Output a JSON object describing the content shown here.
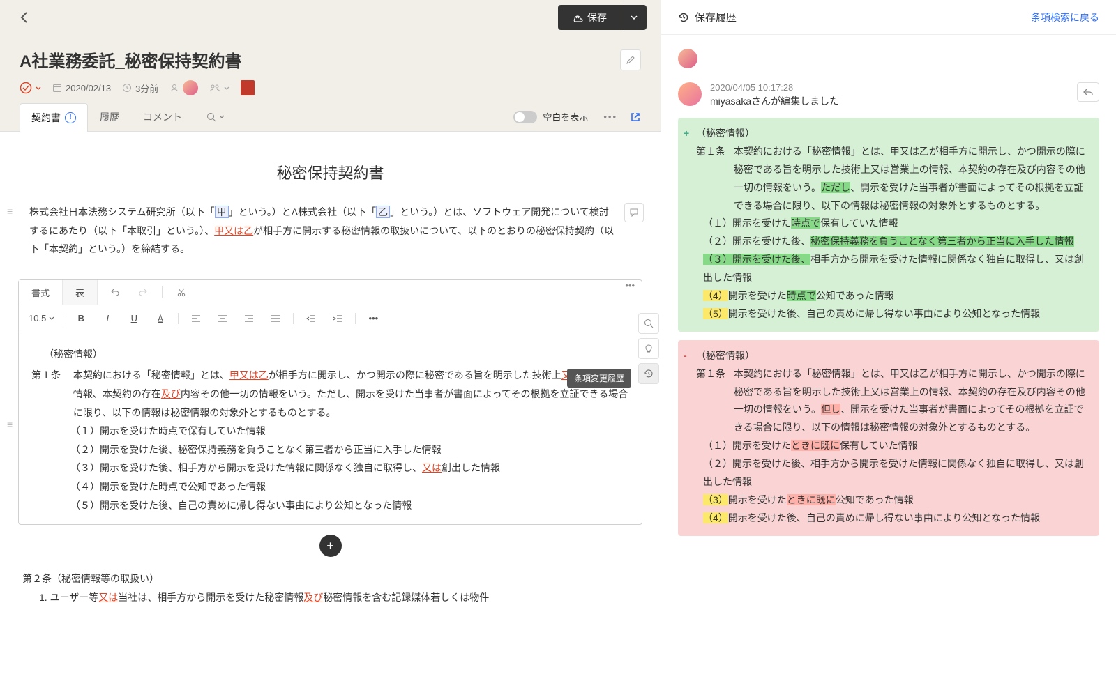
{
  "header": {
    "save_label": "保存"
  },
  "doc": {
    "title": "A社業務委託_秘密保持契約書",
    "date": "2020/02/13",
    "time_ago": "3分前"
  },
  "tabs": {
    "contract": "契約書",
    "history": "履歴",
    "comment": "コメント",
    "show_blank": "空白を表示"
  },
  "body": {
    "title": "秘密保持契約書",
    "pre_1": "株式会社日本法務システム研究所（以下「",
    "pre_ko": "甲",
    "pre_2": "」という。）とA株式会社（以下「",
    "pre_otsu": "乙",
    "pre_3": "」という。）とは、ソフトウェア開発について検討するにあたり（以下「本取引」という。）、",
    "pre_redspan": "甲又は乙",
    "pre_4": "が相手方に開示する秘密情報の取扱いについて、以下のとおりの秘密保持契約（以下「本契約」という。）を締結する。"
  },
  "editor": {
    "tab_format": "書式",
    "tab_table": "表",
    "font_size": "10.5",
    "b": "B",
    "i": "I",
    "u": "U",
    "section_title": "（秘密情報）",
    "art_num": "第１条",
    "art_body_1": "本契約における「秘密情報」とは、",
    "art_red_1": "甲又は乙",
    "art_body_2": "が相手方に開示し、かつ開示の際に秘密である旨を明示した技術上",
    "art_red_2": "又は",
    "art_body_3": "営業上の情報、本契約の存在",
    "art_red_3": "及び",
    "art_body_4": "内容その他一切の情報をいう。ただし、開示を受けた当事者が書面によってその根拠を立証できる場合に限り、以下の情報は秘密情報の対象外とするものとする。",
    "li1": "（１）開示を受けた時点で保有していた情報",
    "li2": "（２）開示を受けた後、秘密保持義務を負うことなく第三者から正当に入手した情報",
    "li3_a": "（３）開示を受けた後、相手方から開示を受けた情報に関係なく独自に取得し、",
    "li3_red": "又は",
    "li3_b": "創出した情報",
    "li4": "（４）開示を受けた時点で公知であった情報",
    "li5": "（５）開示を受けた後、自己の責めに帰し得ない事由により公知となった情報",
    "art2_title": "第２条（秘密情報等の取扱い）",
    "art2_li_a": "1. ユーザー等",
    "art2_li_red": "又は",
    "art2_li_b": "当社は、相手方から開示を受けた秘密情報",
    "art2_li_red2": "及び",
    "art2_li_c": "秘密情報を含む記録媒体若しくは物件"
  },
  "tooltip": "条項変更履歴",
  "right": {
    "title": "保存履歴",
    "back_link": "条項検索に戻る",
    "timestamp": "2020/04/05 10:17:28",
    "author": "miyasakaさんが編集しました"
  },
  "diff_add": {
    "sign": "+",
    "section": "（秘密情報）",
    "art_num": "第１条",
    "body_1": "本契約における「秘密情報」とは、甲又は乙が相手方に開示し、かつ開示の際に秘密である旨を明示した技術上又は営業上の情報、本契約の存在及び内容その他一切の情報をいう。",
    "hl_tadashi": "ただし",
    "body_2": "、開示を受けた当事者が書面によってその根拠を立証できる場合に限り、以下の情報は秘密情報の対象外とするものとする。",
    "li1_a": "（１）開示を受けた",
    "li1_hl": "時点で",
    "li1_b": "保有していた情報",
    "li2_a": "（２）開示を受けた後、",
    "li2_hl": "秘密保持義務を負うことなく第三者から正当に入手した情報",
    "li3_hl": "（３）開示を受けた後、",
    "li3_b": "相手方から開示を受けた情報に関係なく独自に取得し、又は創出した情報",
    "li4_num": "（4）",
    "li4_a": "開示を受けた",
    "li4_hl": "時点で",
    "li4_b": "公知であった情報",
    "li5_num": "（5）",
    "li5": "開示を受けた後、自己の責めに帰し得ない事由により公知となった情報"
  },
  "diff_del": {
    "sign": "-",
    "section": "（秘密情報）",
    "art_num": "第１条",
    "body_1": "本契約における「秘密情報」とは、甲又は乙が相手方に開示し、かつ開示の際に秘密である旨を明示した技術上又は営業上の情報、本契約の存在及び内容その他一切の情報をいう。",
    "hl_tadashi": "但し",
    "body_2": "、開示を受けた当事者が書面によってその根拠を立証できる場合に限り、以下の情報は秘密情報の対象外とするものとする。",
    "li1_a": "（１）開示を受けた",
    "li1_hl": "ときに既に",
    "li1_b": "保有していた情報",
    "li2": "（２）開示を受けた後、相手方から開示を受けた情報に関係なく独自に取得し、又は創出した情報",
    "li3_num": "（3）",
    "li3_a": "開示を受けた",
    "li3_hl": "ときに既に",
    "li3_b": "公知であった情報",
    "li4_num": "（4）",
    "li4": "開示を受けた後、自己の責めに帰し得ない事由により公知となった情報"
  }
}
